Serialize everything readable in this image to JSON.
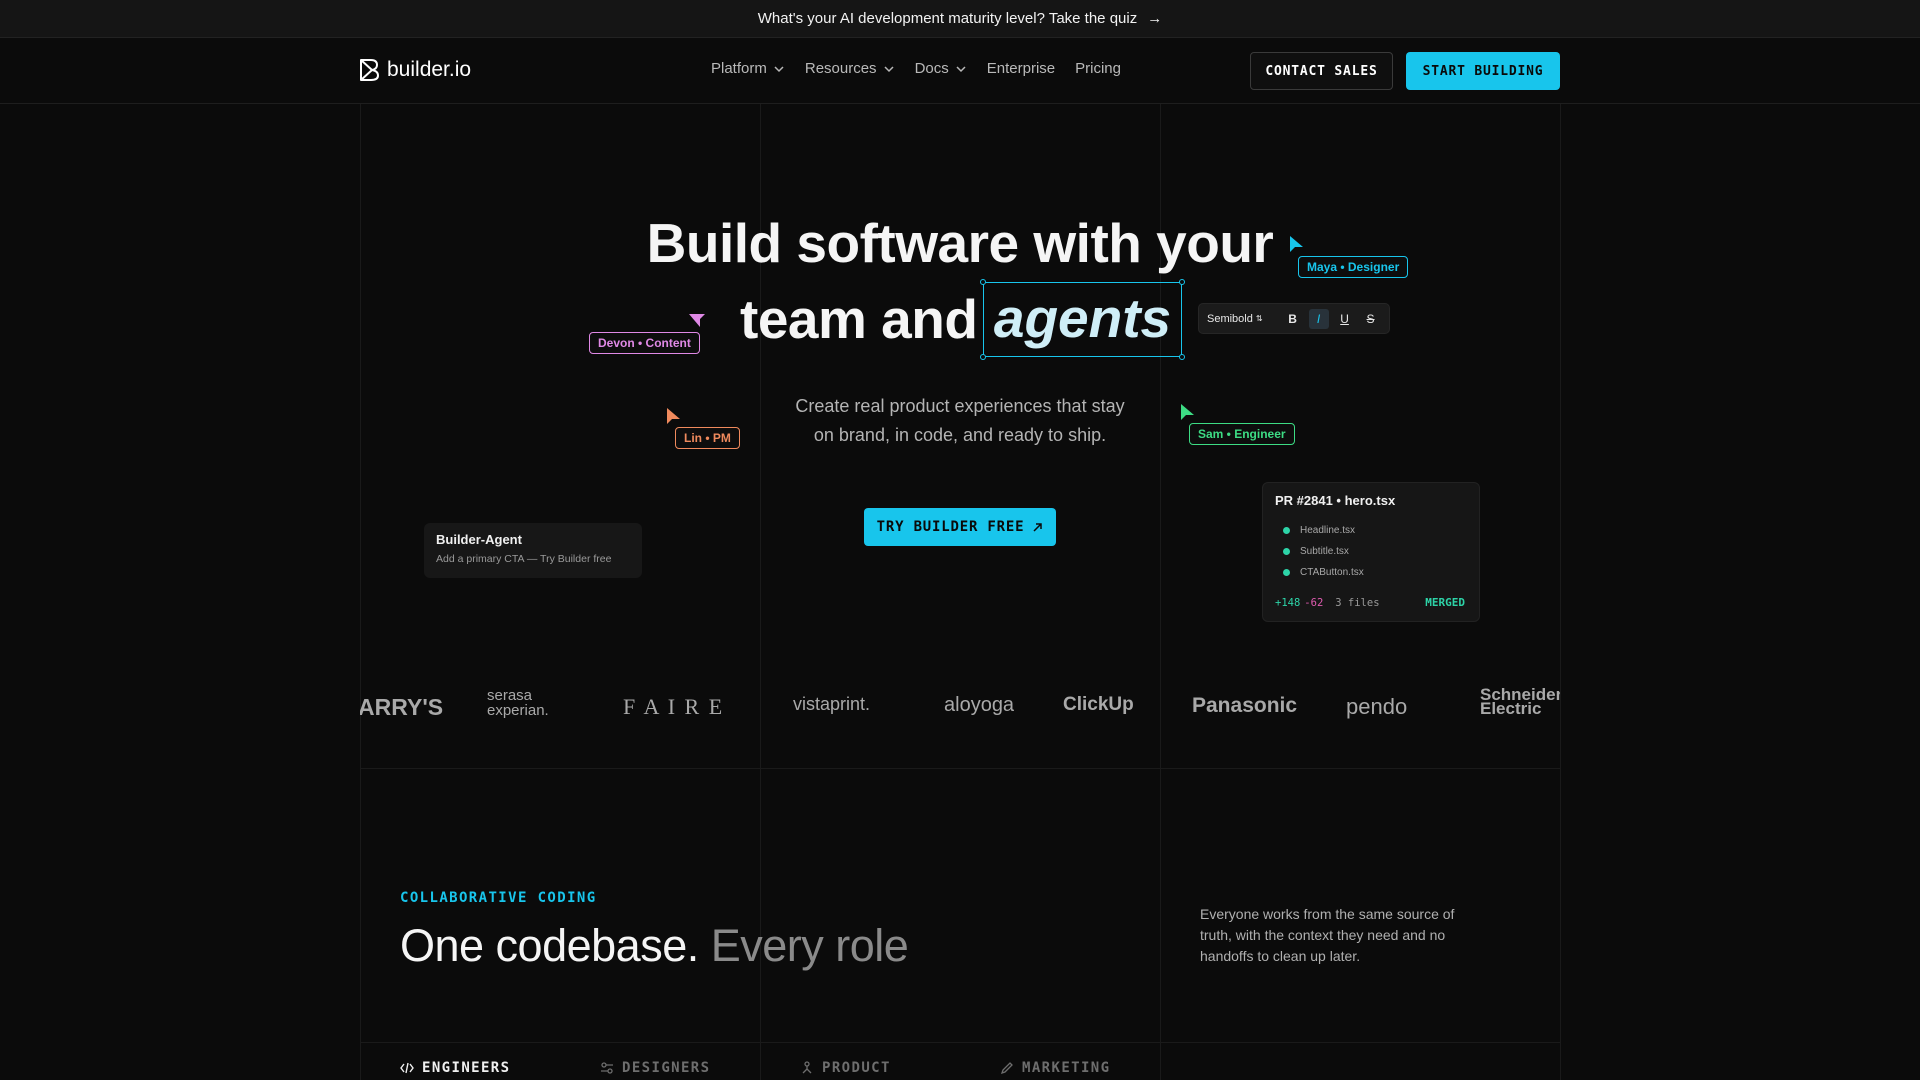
{
  "announcement": {
    "text": "What's your AI development maturity level? Take the quiz",
    "arrow": "→"
  },
  "header": {
    "logo_text": "builder.io",
    "nav": [
      {
        "label": "Platform",
        "has_dropdown": true
      },
      {
        "label": "Resources",
        "has_dropdown": true
      },
      {
        "label": "Docs",
        "has_dropdown": true
      },
      {
        "label": "Enterprise",
        "has_dropdown": false
      },
      {
        "label": "Pricing",
        "has_dropdown": false
      }
    ],
    "contact_label": "CONTACT SALES",
    "start_label": "START BUILDING"
  },
  "hero": {
    "title_line1": "Build software with your",
    "title_line2_prefix": "team and",
    "title_highlight": "agents",
    "subtitle_line1": "Create real product experiences that stay",
    "subtitle_line2": "on brand, in code, and ready to ship.",
    "cta_label": "TRY BUILDER FREE",
    "cta_icon": "arrow-up-right-icon"
  },
  "toolbar": {
    "font_weight": "Semibold",
    "bold": "B",
    "italic": "I",
    "underline": "U",
    "strike": "S"
  },
  "collaborators": [
    {
      "label": "Maya • Designer",
      "color": "#18c5ec"
    },
    {
      "label": "Devon • Content",
      "color": "#e089e6"
    },
    {
      "label": "Lin • PM",
      "color": "#f08a5d"
    },
    {
      "label": "Sam • Engineer",
      "color": "#3ddc84"
    }
  ],
  "agent_card": {
    "title": "Builder-Agent",
    "message": "Add a primary CTA — Try Builder free"
  },
  "pr_card": {
    "title": "PR #2841 • hero.tsx",
    "files": [
      "Headline.tsx",
      "Subtitle.tsx",
      "CTAButton.tsx"
    ],
    "additions": "+148",
    "deletions": "-62",
    "file_count": "3 files",
    "status": "MERGED"
  },
  "logos": [
    "ARRY'S",
    "serasa experian.",
    "F A I R E",
    "vistaprint.",
    "aloyoga",
    "ClickUp",
    "Panasonic",
    "pendo",
    "Schneider Electric"
  ],
  "section": {
    "eyebrow": "COLLABORATIVE CODING",
    "title_strong": "One codebase.",
    "title_muted": "Every role",
    "description": "Everyone works from the same source of truth, with the context they need and no handoffs to clean up later.",
    "tabs": [
      {
        "label": "ENGINEERS",
        "icon": "code-icon",
        "active": true
      },
      {
        "label": "DESIGNERS",
        "icon": "design-icon",
        "active": false
      },
      {
        "label": "PRODUCT",
        "icon": "product-icon",
        "active": false
      },
      {
        "label": "MARKETING",
        "icon": "pen-icon",
        "active": false
      }
    ]
  },
  "colors": {
    "accent": "#18c5ec",
    "background": "#0b0b0b",
    "green": "#2dd4a8",
    "pink": "#e05bb0"
  }
}
